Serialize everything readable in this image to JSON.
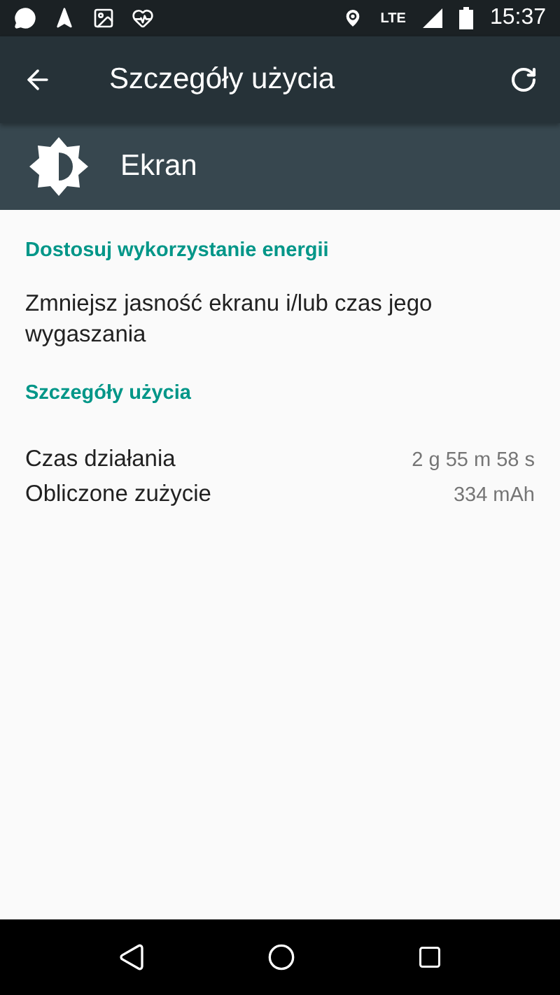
{
  "status_bar": {
    "time": "15:37",
    "network": "LTE"
  },
  "toolbar": {
    "title": "Szczegóły użycia"
  },
  "header": {
    "title": "Ekran"
  },
  "sections": [
    {
      "title": "Dostosuj wykorzystanie energii",
      "rows": [
        {
          "kind": "text",
          "label": "Zmniejsz jasność ekranu i/lub czas jego wygaszania"
        }
      ]
    },
    {
      "title": "Szczegóły użycia",
      "rows": [
        {
          "kind": "pair",
          "label": "Czas działania",
          "value": "2 g 55 m 58 s"
        },
        {
          "kind": "pair",
          "label": "Obliczone zużycie",
          "value": "334 mAh"
        }
      ]
    }
  ]
}
